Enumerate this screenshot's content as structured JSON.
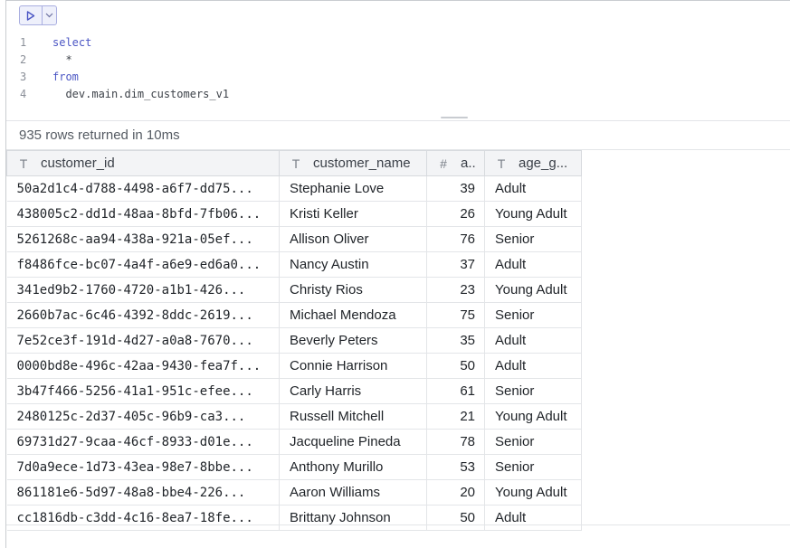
{
  "toolbar": {
    "run_icon": "play-icon",
    "dropdown_icon": "chevron-down-icon"
  },
  "editor": {
    "lines": [
      {
        "number": "1",
        "text": "select",
        "kind": "keyword"
      },
      {
        "number": "2",
        "text": "  *",
        "kind": "ident"
      },
      {
        "number": "3",
        "text": "from",
        "kind": "keyword"
      },
      {
        "number": "4",
        "text": "  dev.main.dim_customers_v1",
        "kind": "ident"
      }
    ]
  },
  "results": {
    "status": "935 rows returned in 10ms",
    "columns": [
      {
        "type_icon": "T",
        "label": "customer_id"
      },
      {
        "type_icon": "T",
        "label": "customer_name"
      },
      {
        "type_icon": "#",
        "label": "a.."
      },
      {
        "type_icon": "T",
        "label": "age_g..."
      }
    ],
    "rows": [
      [
        "50a2d1c4-d788-4498-a6f7-dd75...",
        "Stephanie Love",
        "39",
        "Adult"
      ],
      [
        "438005c2-dd1d-48aa-8bfd-7fb06...",
        "Kristi Keller",
        "26",
        "Young Adult"
      ],
      [
        "5261268c-aa94-438a-921a-05ef...",
        "Allison Oliver",
        "76",
        "Senior"
      ],
      [
        "f8486fce-bc07-4a4f-a6e9-ed6a0...",
        "Nancy Austin",
        "37",
        "Adult"
      ],
      [
        "341ed9b2-1760-4720-a1b1-426...",
        "Christy Rios",
        "23",
        "Young Adult"
      ],
      [
        "2660b7ac-6c46-4392-8ddc-2619...",
        "Michael Mendoza",
        "75",
        "Senior"
      ],
      [
        "7e52ce3f-191d-4d27-a0a8-7670...",
        "Beverly Peters",
        "35",
        "Adult"
      ],
      [
        "0000bd8e-496c-42aa-9430-fea7f...",
        "Connie Harrison",
        "50",
        "Adult"
      ],
      [
        "3b47f466-5256-41a1-951c-efee...",
        "Carly Harris",
        "61",
        "Senior"
      ],
      [
        "2480125c-2d37-405c-96b9-ca3...",
        "Russell Mitchell",
        "21",
        "Young Adult"
      ],
      [
        "69731d27-9caa-46cf-8933-d01e...",
        "Jacqueline Pineda",
        "78",
        "Senior"
      ],
      [
        "7d0a9ece-1d73-43ea-98e7-8bbe...",
        "Anthony Murillo",
        "53",
        "Senior"
      ],
      [
        "861181e6-5d97-48a8-bbe4-226...",
        "Aaron Williams",
        "20",
        "Young Adult"
      ],
      [
        "cc1816db-c3dd-4c16-8ea7-18fe...",
        "Brittany Johnson",
        "50",
        "Adult"
      ]
    ]
  }
}
